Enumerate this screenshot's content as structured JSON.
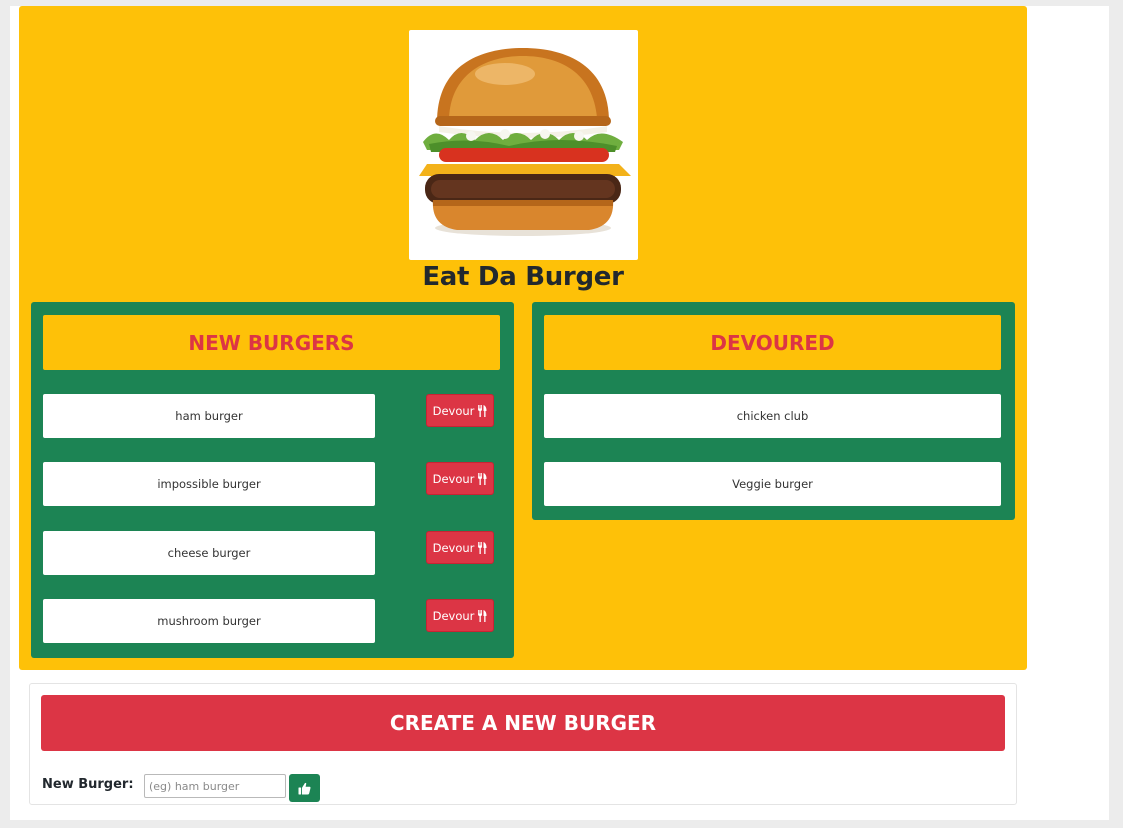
{
  "app": {
    "title": "Eat Da Burger"
  },
  "new_burgers": {
    "heading": "NEW BURGERS",
    "items": [
      {
        "name": "ham burger",
        "action": "Devour"
      },
      {
        "name": "impossible burger",
        "action": "Devour"
      },
      {
        "name": "cheese burger",
        "action": "Devour"
      },
      {
        "name": "mushroom burger",
        "action": "Devour"
      }
    ]
  },
  "devoured": {
    "heading": "DEVOURED",
    "items": [
      {
        "name": "chicken club"
      },
      {
        "name": "Veggie burger"
      }
    ]
  },
  "create": {
    "heading": "CREATE A NEW BURGER",
    "label": "New Burger:",
    "placeholder": "(eg) ham burger",
    "value": ""
  },
  "icons": {
    "devour_icon": "utensils-icon",
    "submit_icon": "thumbs-up-icon",
    "hero_image": "burger-image"
  },
  "colors": {
    "background": "#fec108",
    "panel": "#1c8454",
    "accent": "#dc3545",
    "text": "#22282e"
  }
}
